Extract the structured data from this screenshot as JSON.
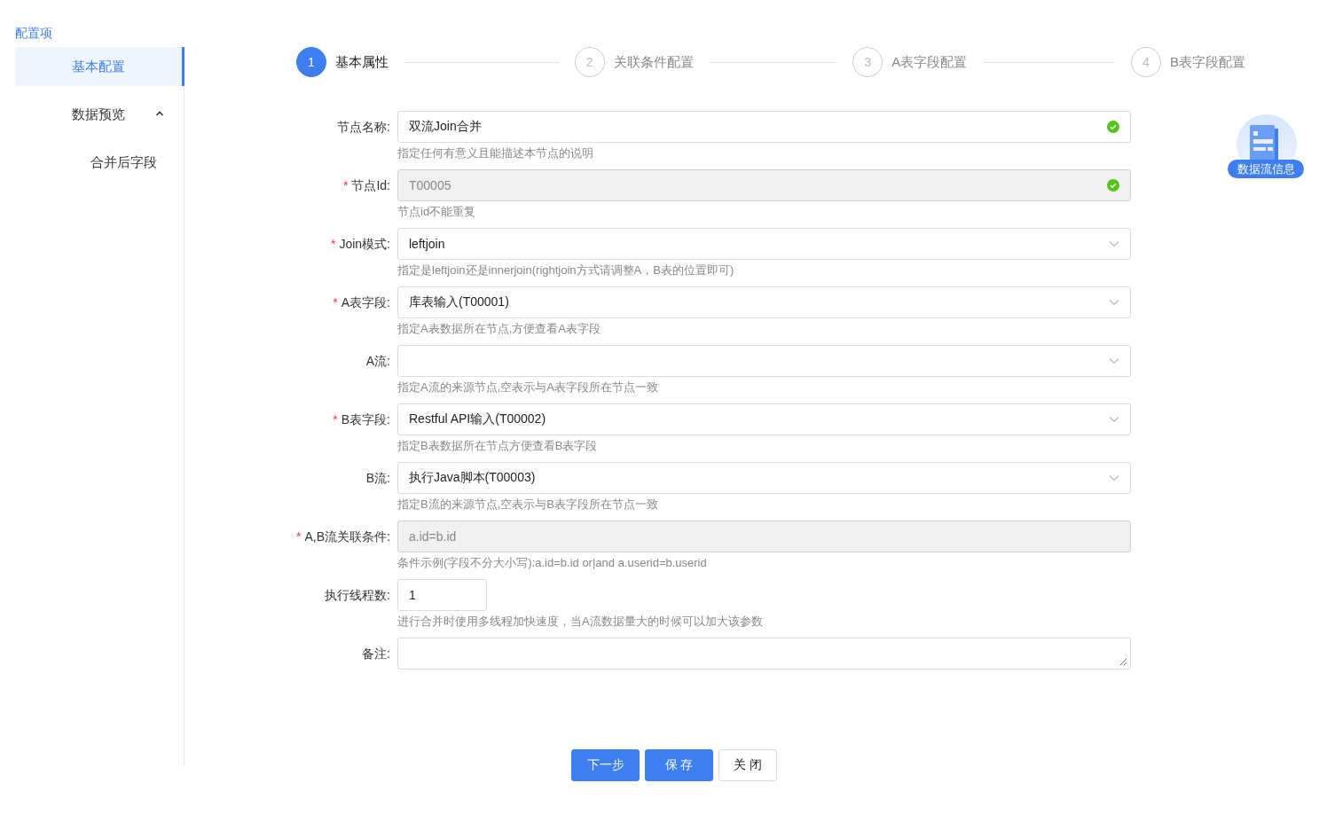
{
  "sidebar": {
    "title": "配置项",
    "items": [
      {
        "label": "基本配置",
        "selected": true
      },
      {
        "label": "数据预览",
        "selected": false,
        "expanded": true,
        "children": [
          {
            "label": "合并后字段",
            "selected": false
          }
        ]
      }
    ]
  },
  "steps": [
    {
      "number": "1",
      "label": "基本属性",
      "selected": true
    },
    {
      "number": "2",
      "label": "关联条件配置",
      "selected": false
    },
    {
      "number": "3",
      "label": "A表字段配置",
      "selected": false
    },
    {
      "number": "4",
      "label": "B表字段配置",
      "selected": false
    }
  ],
  "form": {
    "fields": [
      {
        "kind": "text",
        "label": "节点名称:",
        "value": "双流Join合并",
        "disabled": false,
        "valid": true,
        "hint": "指定任何有意义且能描述本节点的说明"
      },
      {
        "kind": "text",
        "required_mark": "*",
        "label": "节点Id:",
        "value": "T00005",
        "disabled": true,
        "valid": true,
        "hint": "节点id不能重复"
      },
      {
        "kind": "select",
        "required_mark": "*",
        "label": "Join模式:",
        "value": "leftjoin",
        "disabled": false,
        "valid": false,
        "hint": "指定是leftjoin还是innerjoin(rightjoin方式请调整A，B表的位置即可)"
      },
      {
        "kind": "select",
        "required_mark": "*",
        "label": "A表字段:",
        "value": "库表输入(T00001)",
        "disabled": false,
        "valid": false,
        "hint": "指定A表数据所在节点,方便查看A表字段"
      },
      {
        "kind": "select",
        "label": "A流:",
        "disabled": false,
        "valid": false,
        "hint": "指定A流的来源节点,空表示与A表字段所在节点一致"
      },
      {
        "kind": "select",
        "required_mark": "*",
        "label": "B表字段:",
        "value": "Restful API输入(T00002)",
        "disabled": false,
        "valid": false,
        "hint": "指定B表数据所在节点方便查看B表字段"
      },
      {
        "kind": "select",
        "label": "B流:",
        "value": "执行Java脚本(T00003)",
        "disabled": false,
        "valid": false,
        "hint": "指定B流的来源节点,空表示与B表字段所在节点一致"
      },
      {
        "kind": "text",
        "required_mark": "*",
        "label": "A,B流关联条件:",
        "value": "a.id=b.id",
        "disabled": true,
        "valid": false,
        "hint": "条件示例(字段不分大小写):a.id=b.id or|and a.userid=b.userid"
      },
      {
        "kind": "number",
        "label": "执行线程数:",
        "value": "1",
        "disabled": false,
        "valid": false,
        "hint": "进行合并时使用多线程加快速度，当A流数据量大的时候可以加大该参数"
      },
      {
        "kind": "textarea",
        "label": "备注:",
        "disabled": false
      }
    ]
  },
  "buttons": [
    {
      "label": "下一步",
      "kind": "primary"
    },
    {
      "label": "保 存",
      "kind": "primary"
    },
    {
      "label": "关 闭",
      "kind": "default"
    }
  ],
  "float_badge": {
    "label": "数据流信息"
  }
}
